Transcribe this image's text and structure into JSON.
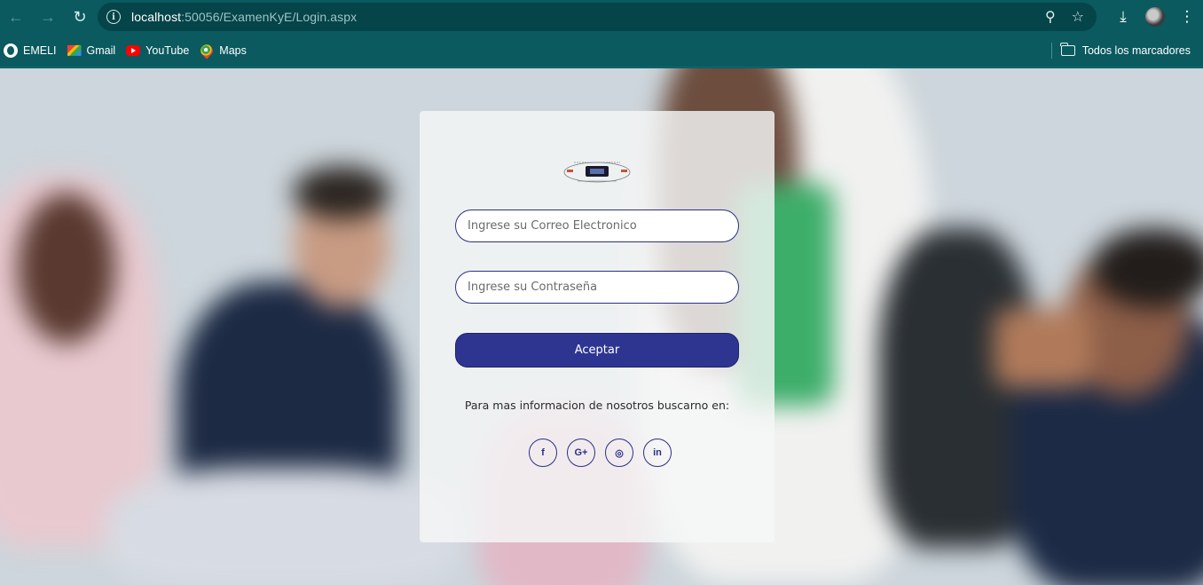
{
  "browser": {
    "url_host": "localhost",
    "url_rest": ":50056/ExamenKyE/Login.aspx",
    "bookmarks": [
      {
        "label": "EMELI",
        "icon": "globe-icon"
      },
      {
        "label": "Gmail",
        "icon": "gmail-icon"
      },
      {
        "label": "YouTube",
        "icon": "youtube-icon"
      },
      {
        "label": "Maps",
        "icon": "maps-icon"
      }
    ],
    "all_bookmarks_label": "Todos los marcadores"
  },
  "login": {
    "email_placeholder": "Ingrese su Correo Electronico",
    "password_placeholder": "Ingrese su Contraseña",
    "submit_label": "Aceptar",
    "info_text": "Para mas informacion de nosotros buscarno en:",
    "socials": [
      {
        "icon": "facebook-icon",
        "glyph": "f"
      },
      {
        "icon": "google-plus-icon",
        "glyph": "G+"
      },
      {
        "icon": "instagram-icon",
        "glyph": "◎"
      },
      {
        "icon": "linkedin-icon",
        "glyph": "in"
      }
    ]
  },
  "colors": {
    "chrome": "#0a5a5f",
    "accent": "#2e3591",
    "field_border": "#2c2f86"
  }
}
